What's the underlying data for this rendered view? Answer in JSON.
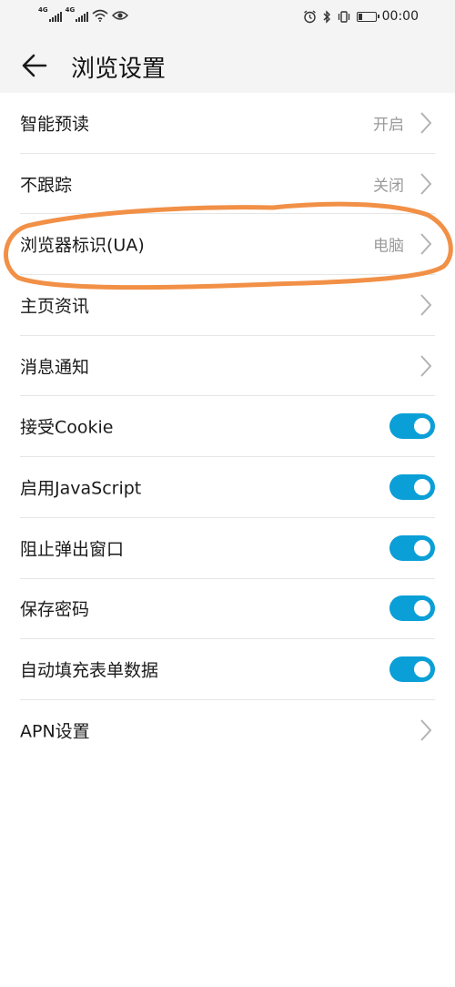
{
  "status_bar": {
    "sim1": "4G",
    "sim2": "4G",
    "time": "00:00",
    "battery_level": 0.2
  },
  "header": {
    "title": "浏览设置",
    "back_icon": "arrow-left-icon"
  },
  "settings": [
    {
      "label": "智能预读",
      "value": "开启",
      "control": "chevron"
    },
    {
      "label": "不跟踪",
      "value": "关闭",
      "control": "chevron"
    },
    {
      "label": "浏览器标识(UA)",
      "value": "电脑",
      "control": "chevron"
    },
    {
      "label": "主页资讯",
      "value": "",
      "control": "chevron"
    },
    {
      "label": "消息通知",
      "value": "",
      "control": "chevron"
    },
    {
      "label": "接受Cookie",
      "control": "toggle",
      "on": true
    },
    {
      "label": "启用JavaScript",
      "control": "toggle",
      "on": true
    },
    {
      "label": "阻止弹出窗口",
      "control": "toggle",
      "on": true
    },
    {
      "label": "保存密码",
      "control": "toggle",
      "on": true
    },
    {
      "label": "自动填充表单数据",
      "control": "toggle",
      "on": true
    },
    {
      "label": "APN设置",
      "value": "",
      "control": "chevron"
    }
  ],
  "colors": {
    "toggle_on": "#0a9fd6",
    "annotation": "#f08a3c",
    "value_text": "#9a9a9a"
  }
}
